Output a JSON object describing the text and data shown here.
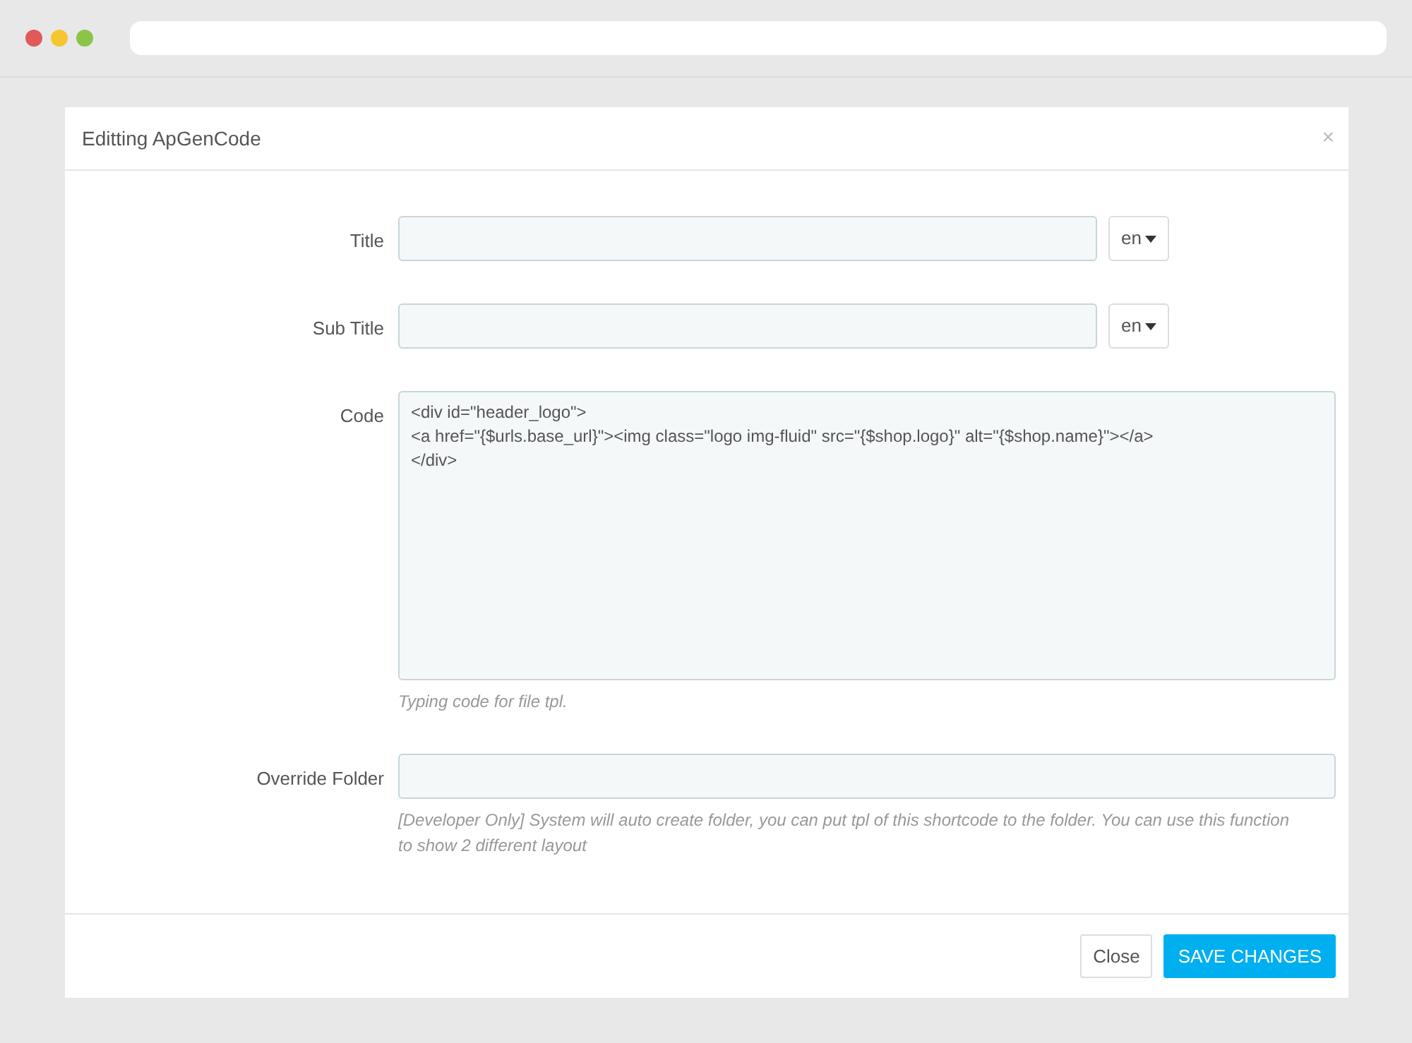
{
  "window": {
    "title": "Editting ApGenCode",
    "close": "×"
  },
  "fields": [
    {
      "kind": "input",
      "label": "Title",
      "language": "en"
    },
    {
      "kind": "input",
      "label": "Sub Title",
      "language": "en"
    },
    {
      "kind": "textarea",
      "label": "Code",
      "value": "<div id=\"header_logo\">\n<a href=\"{$urls.base_url}\"><img class=\"logo img-fluid\" src=\"{$shop.logo}\" alt=\"{$shop.name}\"></a>\n</div>",
      "help": "Typing code for file tpl."
    },
    {
      "kind": "input",
      "label": "Override Folder",
      "help": "[Developer Only] System will auto create folder, you can put tpl of this shortcode to the folder. You can use this function to show 2 different layout"
    }
  ],
  "buttons": [
    {
      "label": "Close",
      "kind": "secondary"
    },
    {
      "label": "SAVE CHANGES",
      "kind": "primary"
    }
  ]
}
